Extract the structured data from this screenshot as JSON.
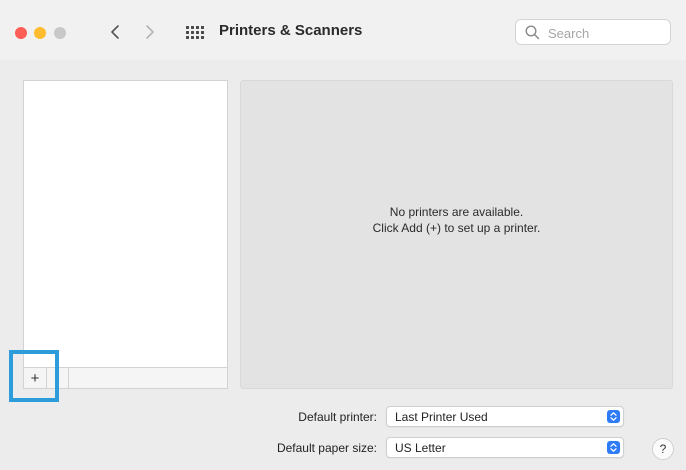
{
  "window": {
    "title": "Printers & Scanners"
  },
  "toolbar": {
    "search_placeholder": "Search"
  },
  "printer_list": {
    "add_label": "+",
    "remove_label": "-"
  },
  "detail": {
    "line1": "No printers are available.",
    "line2": "Click Add (+) to set up a printer."
  },
  "settings": {
    "default_printer_label": "Default printer:",
    "default_printer_value": "Last Printer Used",
    "paper_size_label": "Default paper size:",
    "paper_size_value": "US Letter"
  },
  "help_label": "?",
  "icons": {
    "back": "chevron-left-icon",
    "forward": "chevron-right-icon",
    "show_all": "grid-icon",
    "search": "search-icon",
    "popup": "updown-chevron-icon"
  },
  "colors": {
    "accent": "#2f7cf6",
    "highlight": "#2d9cdb",
    "close": "#ff5f57",
    "minimize": "#febc2e"
  }
}
